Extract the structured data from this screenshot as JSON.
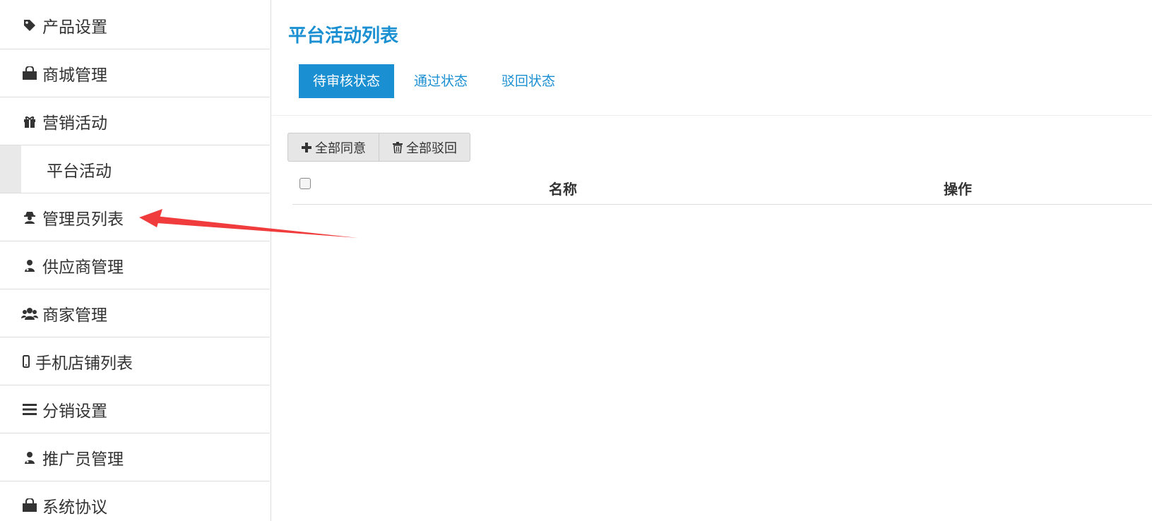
{
  "sidebar": {
    "items": [
      {
        "label": "产品设置",
        "icon": "tag-icon"
      },
      {
        "label": "商城管理",
        "icon": "shopping-bag-icon"
      },
      {
        "label": "营销活动",
        "icon": "gift-icon"
      },
      {
        "label": "平台活动",
        "icon": ""
      },
      {
        "label": "管理员列表",
        "icon": "user-secret-icon"
      },
      {
        "label": "供应商管理",
        "icon": "user-md-icon"
      },
      {
        "label": "商家管理",
        "icon": "users-icon"
      },
      {
        "label": "手机店铺列表",
        "icon": "mobile-icon"
      },
      {
        "label": "分销设置",
        "icon": "bars-icon"
      },
      {
        "label": "推广员管理",
        "icon": "user-md-icon"
      },
      {
        "label": "系统协议",
        "icon": "shopping-bag-icon"
      }
    ]
  },
  "main": {
    "title": "平台活动列表",
    "tabs": [
      {
        "label": "待审核状态",
        "active": true
      },
      {
        "label": "通过状态",
        "active": false
      },
      {
        "label": "驳回状态",
        "active": false
      }
    ],
    "actions": {
      "approve_all": "全部同意",
      "reject_all": "全部驳回"
    },
    "table": {
      "columns": [
        "名称",
        "操作"
      ]
    }
  },
  "colors": {
    "accent": "#1a8fd1",
    "annotation_arrow": "#f03c3c"
  }
}
